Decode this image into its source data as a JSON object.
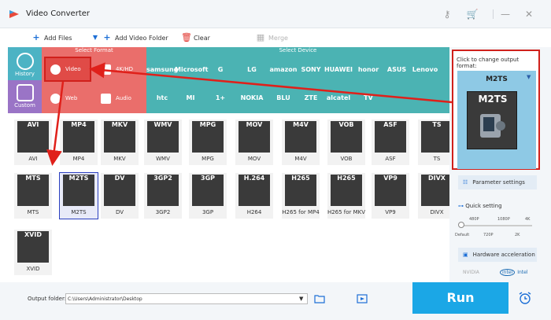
{
  "app": {
    "title": "Video Converter"
  },
  "toolbar": {
    "add_files": "Add Files",
    "add_video_folder": "Add Video Folder",
    "clear": "Clear",
    "merge": "Merge"
  },
  "sections": {
    "select_format": "Select Format",
    "select_device": "Select Device"
  },
  "categories": {
    "history": "History",
    "custom": "Custom"
  },
  "format_types": {
    "video": "Video",
    "hd": "4K/HD",
    "web": "Web",
    "audio": "Audio"
  },
  "devices": [
    "samsung",
    "Microsoft",
    "G",
    "LG",
    "amazon",
    "SONY",
    "HUAWEI",
    "honor",
    "ASUS",
    "Lenovo",
    "htc",
    "MI",
    "1+",
    "NOKIA",
    "BLU",
    "ZTE",
    "alcatel",
    "TV"
  ],
  "formats": [
    {
      "tag": "AVI",
      "label": "AVI"
    },
    {
      "tag": "MP4",
      "label": "MP4"
    },
    {
      "tag": "MKV",
      "label": "MKV"
    },
    {
      "tag": "WMV",
      "label": "WMV"
    },
    {
      "tag": "MPG",
      "label": "MPG"
    },
    {
      "tag": "MOV",
      "label": "MOV"
    },
    {
      "tag": "M4V",
      "label": "M4V"
    },
    {
      "tag": "VOB",
      "label": "VOB"
    },
    {
      "tag": "ASF",
      "label": "ASF"
    },
    {
      "tag": "TS",
      "label": "TS"
    },
    {
      "tag": "MTS",
      "label": "MTS"
    },
    {
      "tag": "M2TS",
      "label": "M2TS"
    },
    {
      "tag": "DV",
      "label": "DV"
    },
    {
      "tag": "3GP2",
      "label": "3GP2"
    },
    {
      "tag": "3GP",
      "label": "3GP"
    },
    {
      "tag": "H.264",
      "label": "H264"
    },
    {
      "tag": "H265",
      "label": "H265 for MP4"
    },
    {
      "tag": "H265",
      "label": "H265 for MKV"
    },
    {
      "tag": "VP9",
      "label": "VP9"
    },
    {
      "tag": "DIVX",
      "label": "DIVX"
    },
    {
      "tag": "XVID",
      "label": "XVID"
    }
  ],
  "output": {
    "caption": "Click to change output format:",
    "format": "M2TS"
  },
  "settings": {
    "parameter": "Parameter settings",
    "quick": "Quick setting",
    "ticks_top": [
      "480P",
      "1080P",
      "4K"
    ],
    "ticks_bottom": [
      "Default",
      "720P",
      "2K"
    ],
    "hw_accel": "Hardware acceleration",
    "nvidia": "NVIDIA",
    "intel": "Intel"
  },
  "bottom": {
    "output_folder_label": "Output folder:",
    "output_path": "C:\\Users\\Administrator\\Desktop",
    "run": "Run"
  }
}
